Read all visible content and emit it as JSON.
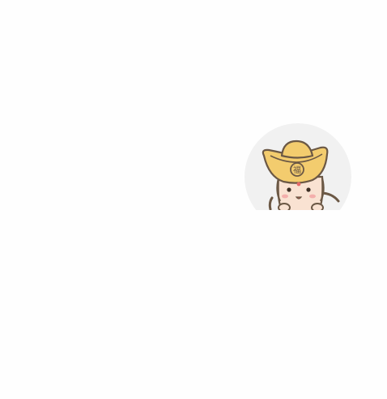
{
  "avatar": {
    "icon": "cartoon-character-with-gold-ingot-hat-icon",
    "background_color": "#f1f1f1",
    "hat_color": "#f3cc6e",
    "outline_color": "#6b5845",
    "skin_color": "#f9e2d2",
    "cheek_color": "#f3a2a2",
    "hat_emblem_text": "福"
  }
}
